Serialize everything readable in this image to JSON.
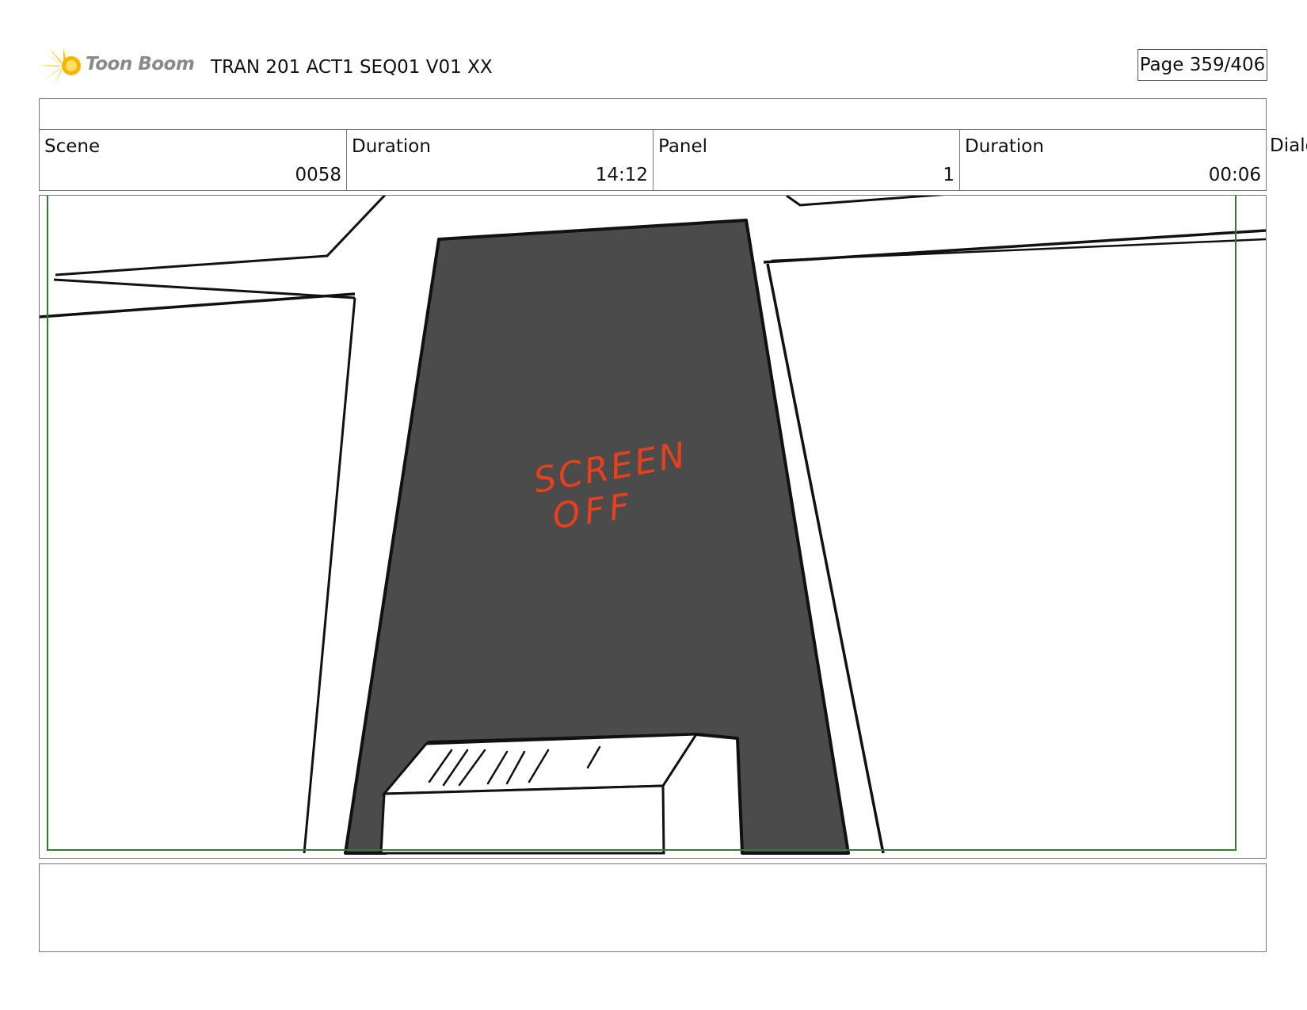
{
  "header": {
    "logo_text": "Toon Boom",
    "project_title": "TRAN 201 ACT1 SEQ01 V01 XX",
    "page": "Page 359/406"
  },
  "info": {
    "scene_label": "Scene",
    "scene_value": "0058",
    "scene_duration_label": "Duration",
    "scene_duration_value": "14:12",
    "panel_label": "Panel",
    "panel_value": "1",
    "panel_duration_label": "Duration",
    "panel_duration_value": "00:06",
    "dialog_label": "Dialog"
  },
  "panel": {
    "annotation_line1": "SCREEN",
    "annotation_line2": "OFF",
    "annotation_color": "#e8401c",
    "screen_fill": "#4b4b4b",
    "safe_frame_color": "#2e7d32"
  }
}
